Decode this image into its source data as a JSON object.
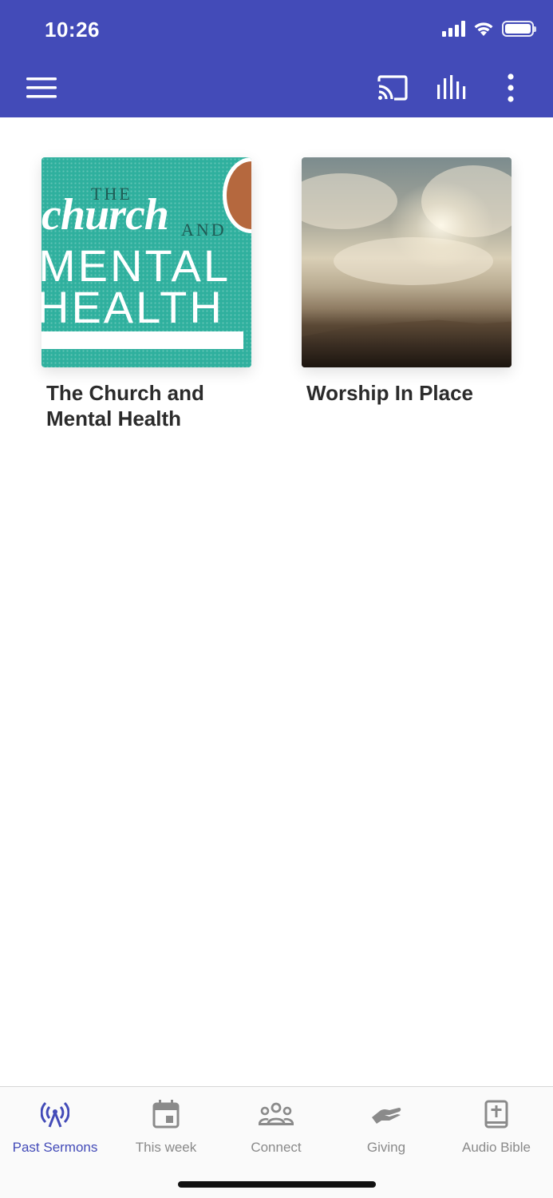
{
  "status_bar": {
    "time": "10:26"
  },
  "toolbar": {
    "menu_icon": "hamburger-menu-icon",
    "cast_icon": "cast-icon",
    "audio_icon": "audio-levels-icon",
    "more_icon": "more-vertical-icon",
    "colors": {
      "header": "#434bb8"
    }
  },
  "series": [
    {
      "title": "The Church and Mental Health",
      "artwork": {
        "the": "THE",
        "church": "church",
        "and": "AND",
        "mental": "MENTAL",
        "health": "HEALTH"
      }
    },
    {
      "title": "Worship In Place"
    }
  ],
  "tabs": [
    {
      "label": "Past Sermons",
      "icon": "broadcast-icon",
      "active": true
    },
    {
      "label": "This week",
      "icon": "calendar-icon",
      "active": false
    },
    {
      "label": "Connect",
      "icon": "people-icon",
      "active": false
    },
    {
      "label": "Giving",
      "icon": "giving-hand-icon",
      "active": false
    },
    {
      "label": "Audio Bible",
      "icon": "bible-icon",
      "active": false
    }
  ]
}
